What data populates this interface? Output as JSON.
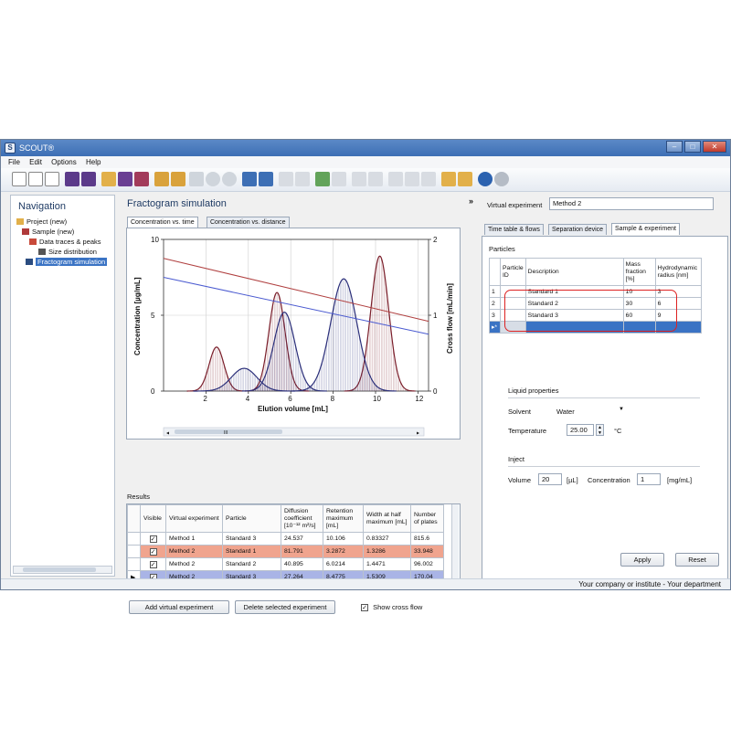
{
  "window": {
    "title": "SCOUT®"
  },
  "menu": [
    "File",
    "Edit",
    "Options",
    "Help"
  ],
  "navigation": {
    "title": "Navigation",
    "tree": [
      {
        "label": "Project (new)",
        "level": 0
      },
      {
        "label": "Sample (new)",
        "level": 1
      },
      {
        "label": "Data traces & peaks",
        "level": 2
      },
      {
        "label": "Size distribution",
        "level": 2
      },
      {
        "label": "Fractogram simulation",
        "level": 1,
        "selected": true
      }
    ]
  },
  "main": {
    "title": "Fractogram simulation",
    "tabs": [
      "Concentration vs. time",
      "Concentration vs. distance"
    ],
    "collapse_glyph": "»",
    "scroll_glyph": "III"
  },
  "chart_data": {
    "type": "line",
    "xlabel": "Elution volume [mL]",
    "ylabel": "Concentration [µg/mL]",
    "y2label": "Cross flow [mL/min]",
    "xlim": [
      0,
      12.5
    ],
    "ylim": [
      0,
      10
    ],
    "y2lim": [
      0,
      2
    ],
    "xticks": [
      2,
      4,
      6,
      8,
      10,
      12
    ],
    "yticks": [
      0,
      5,
      10
    ],
    "y2ticks": [
      0,
      1,
      2
    ],
    "grid": true,
    "series": [
      {
        "color": "#7b1f2b",
        "peaks": [
          {
            "mu": 2.5,
            "sigma": 0.35,
            "height": 2.9
          },
          {
            "mu": 5.35,
            "sigma": 0.38,
            "height": 6.5
          },
          {
            "mu": 10.2,
            "sigma": 0.42,
            "height": 8.9
          }
        ]
      },
      {
        "color": "#2b2f7a",
        "peaks": [
          {
            "mu": 3.8,
            "sigma": 0.6,
            "height": 1.5
          },
          {
            "mu": 5.7,
            "sigma": 0.5,
            "height": 5.2
          },
          {
            "mu": 8.5,
            "sigma": 0.62,
            "height": 7.4
          }
        ]
      }
    ],
    "crossflow": [
      {
        "color": "#b04040",
        "x": [
          0,
          12.5
        ],
        "y": [
          1.75,
          0.92
        ]
      },
      {
        "color": "#4a5ad0",
        "x": [
          0,
          12.5
        ],
        "y": [
          1.5,
          0.75
        ]
      }
    ]
  },
  "results": {
    "label": "Results",
    "columns": [
      "Visible",
      "Virtual experiment",
      "Particle",
      "Diffusion coefficient [10⁻¹² m²/s]",
      "Retention maximum [mL]",
      "Width at half maximum [mL]",
      "Number of plates"
    ],
    "rows": [
      {
        "visible": "✓",
        "experiment": "Method 1",
        "particle": "Standard 3",
        "diffusion": "24.537",
        "retention": "10.106",
        "width": "0.83327",
        "plates": "815.6",
        "color": "#ffffff"
      },
      {
        "visible": "✓",
        "experiment": "Method 2",
        "particle": "Standard 1",
        "diffusion": "81.791",
        "retention": "3.2872",
        "width": "1.3286",
        "plates": "33.948",
        "color": "#f0a48e"
      },
      {
        "visible": "✓",
        "experiment": "Method 2",
        "particle": "Standard 2",
        "diffusion": "40.895",
        "retention": "6.0214",
        "width": "1.4471",
        "plates": "96.002",
        "color": "#ffffff"
      },
      {
        "visible": "✓",
        "experiment": "Method 2",
        "particle": "Standard 3",
        "diffusion": "27.264",
        "retention": "8.4775",
        "width": "1.5309",
        "plates": "170.04",
        "color": "#a9b4e6"
      }
    ],
    "row_pointer": "▶"
  },
  "buttons": {
    "add": "Add virtual experiment",
    "delete": "Delete selected experiment",
    "show_cross_flow": "Show cross flow",
    "apply": "Apply",
    "reset": "Reset"
  },
  "right": {
    "ve_label": "Virtual experiment",
    "ve_value": "Method 2",
    "tabs": [
      "Time table & flows",
      "Separation device",
      "Sample & experiment"
    ],
    "particles_label": "Particles",
    "particle_columns": [
      "Particle ID",
      "Description",
      "Mass fraction [%]",
      "Hydrodynamic radius [nm]"
    ],
    "particles": [
      {
        "id": "1",
        "description": "Standard 1",
        "mass": "10",
        "radius": "3"
      },
      {
        "id": "2",
        "description": "Standard 2",
        "mass": "30",
        "radius": "6"
      },
      {
        "id": "3",
        "description": "Standard 3",
        "mass": "60",
        "radius": "9"
      }
    ],
    "new_row_marker": "▸*",
    "liquid_label": "Liquid properties",
    "solvent_label": "Solvent",
    "solvent_value": "Water",
    "temperature_label": "Temperature",
    "temperature_value": "25.00",
    "temperature_unit": "°C",
    "inject_label": "Inject",
    "volume_label": "Volume",
    "volume_value": "20",
    "volume_unit": "[µL]",
    "concentration_label": "Concentration",
    "concentration_value": "1",
    "concentration_unit": "[mg/mL]"
  },
  "status": {
    "text": "Your company or institute - Your department"
  }
}
